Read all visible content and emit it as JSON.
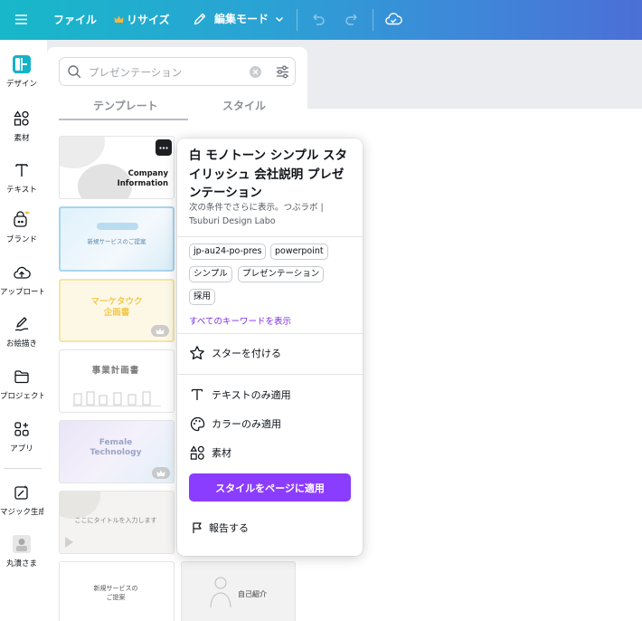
{
  "topbar": {
    "file": "ファイル",
    "resize": "リサイズ",
    "edit_mode": "編集モード",
    "gradient_start": "#17b8c9",
    "gradient_end": "#4b6fd6"
  },
  "rail": {
    "items": [
      {
        "label": "デザイン",
        "icon": "design-icon"
      },
      {
        "label": "素材",
        "icon": "elements-icon"
      },
      {
        "label": "テキスト",
        "icon": "text-icon"
      },
      {
        "label": "ブランド",
        "icon": "brand-icon"
      },
      {
        "label": "アップロード",
        "icon": "upload-icon"
      },
      {
        "label": "お絵描き",
        "icon": "draw-icon"
      },
      {
        "label": "プロジェクト",
        "icon": "folder-icon"
      },
      {
        "label": "アプリ",
        "icon": "apps-icon"
      },
      {
        "label": "マジック生成",
        "icon": "magic-icon"
      },
      {
        "label": "丸潰さま",
        "icon": "avatar-icon"
      }
    ]
  },
  "panel": {
    "search_placeholder": "プレゼンテーション",
    "tabs": [
      "テンプレート",
      "スタイル"
    ],
    "thumbs": [
      {
        "title_1": "Company",
        "title_2": "Information"
      },
      {
        "title": "新規サービスのご提案"
      },
      {
        "title_1": "マーケタウク",
        "title_2": "企画書"
      },
      {
        "title": "事業計画書"
      },
      {
        "title_1": "Female",
        "title_2": "Technology"
      },
      {
        "title": "ここにタイトルを入力します"
      },
      {
        "title_1": "新規サービスの",
        "title_2": "ご提案"
      },
      {
        "title": "自己紹介"
      }
    ]
  },
  "popover": {
    "title": "白 モノトーン シンプル スタイリッシュ 会社説明 プレゼンテーション",
    "subtitle": "次の条件でさらに表示。つぶラボ | Tsuburi Design Labo",
    "tags": [
      "jp-au24-po-pres",
      "powerpoint",
      "シンプル",
      "プレゼンテーション",
      "採用"
    ],
    "show_all_keywords": "すべてのキーワードを表示",
    "star": "スターを付ける",
    "text_only": "テキストのみ適用",
    "color_only": "カラーのみ適用",
    "elements": "素材",
    "apply_style": "スタイルをページに適用",
    "report": "報告する",
    "accent": "#8b3dff"
  }
}
